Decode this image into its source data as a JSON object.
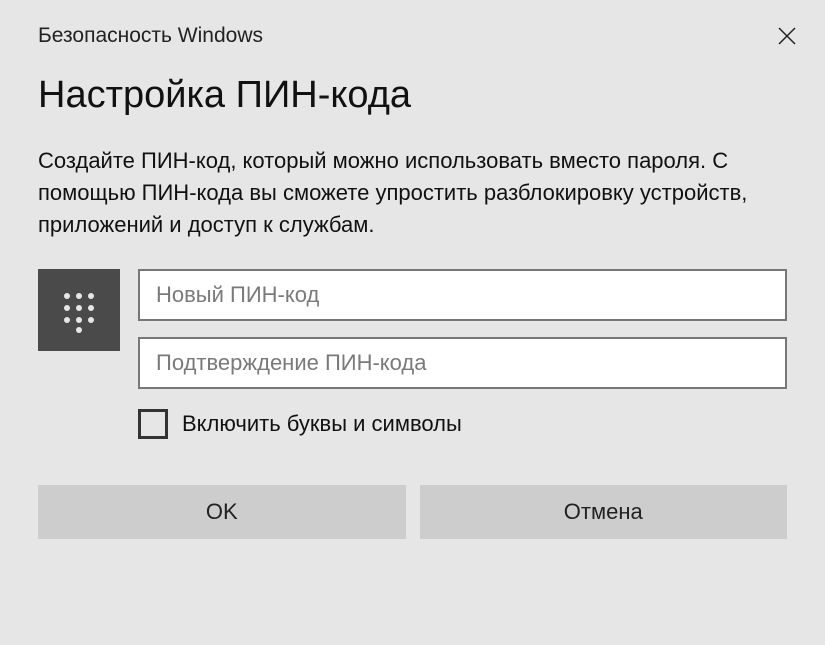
{
  "titlebar": {
    "label": "Безопасность Windows"
  },
  "header": "Настройка ПИН-кода",
  "description": "Создайте ПИН-код, который можно использовать вместо пароля. С помощью ПИН-кода вы сможете упростить разблокировку устройств, приложений и доступ к службам.",
  "fields": {
    "new_pin": {
      "placeholder": "Новый ПИН-код",
      "value": ""
    },
    "confirm_pin": {
      "placeholder": "Подтверждение ПИН-кода",
      "value": ""
    }
  },
  "checkbox": {
    "label": "Включить буквы и символы",
    "checked": false
  },
  "buttons": {
    "ok_label": "OK",
    "cancel_label": "Отмена"
  }
}
